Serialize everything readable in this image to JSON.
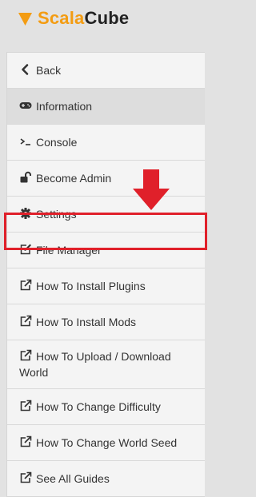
{
  "logo": {
    "part1": "Scala",
    "part2": "Cube"
  },
  "menu": {
    "items": [
      {
        "label": "Back",
        "icon": "chevron-left-icon"
      },
      {
        "label": "Information",
        "icon": "gamepad-icon"
      },
      {
        "label": "Console",
        "icon": "terminal-icon"
      },
      {
        "label": "Become Admin",
        "icon": "unlock-icon"
      },
      {
        "label": "Settings",
        "icon": "gear-icon"
      },
      {
        "label": "File Manager",
        "icon": "edit-icon"
      },
      {
        "label": "How To Install Plugins",
        "icon": "external-link-icon"
      },
      {
        "label": "How To Install Mods",
        "icon": "external-link-icon"
      },
      {
        "label": "How To Upload / Download World",
        "icon": "external-link-icon"
      },
      {
        "label": "How To Change Difficulty",
        "icon": "external-link-icon"
      },
      {
        "label": "How To Change World Seed",
        "icon": "external-link-icon"
      },
      {
        "label": "See All Guides",
        "icon": "external-link-icon"
      }
    ]
  },
  "colors": {
    "brand_orange": "#f39c12",
    "highlight_red": "#e0202a",
    "active_bg": "#dddddd"
  }
}
